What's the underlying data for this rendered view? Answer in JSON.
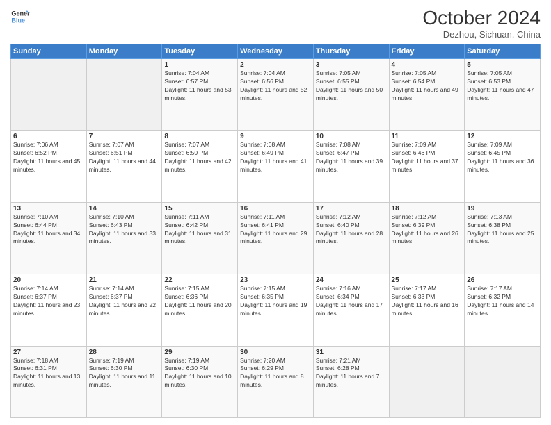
{
  "header": {
    "logo_line1": "General",
    "logo_line2": "Blue",
    "month": "October 2024",
    "location": "Dezhou, Sichuan, China"
  },
  "weekdays": [
    "Sunday",
    "Monday",
    "Tuesday",
    "Wednesday",
    "Thursday",
    "Friday",
    "Saturday"
  ],
  "weeks": [
    [
      {
        "day": "",
        "sunrise": "",
        "sunset": "",
        "daylight": ""
      },
      {
        "day": "",
        "sunrise": "",
        "sunset": "",
        "daylight": ""
      },
      {
        "day": "1",
        "sunrise": "Sunrise: 7:04 AM",
        "sunset": "Sunset: 6:57 PM",
        "daylight": "Daylight: 11 hours and 53 minutes."
      },
      {
        "day": "2",
        "sunrise": "Sunrise: 7:04 AM",
        "sunset": "Sunset: 6:56 PM",
        "daylight": "Daylight: 11 hours and 52 minutes."
      },
      {
        "day": "3",
        "sunrise": "Sunrise: 7:05 AM",
        "sunset": "Sunset: 6:55 PM",
        "daylight": "Daylight: 11 hours and 50 minutes."
      },
      {
        "day": "4",
        "sunrise": "Sunrise: 7:05 AM",
        "sunset": "Sunset: 6:54 PM",
        "daylight": "Daylight: 11 hours and 49 minutes."
      },
      {
        "day": "5",
        "sunrise": "Sunrise: 7:05 AM",
        "sunset": "Sunset: 6:53 PM",
        "daylight": "Daylight: 11 hours and 47 minutes."
      }
    ],
    [
      {
        "day": "6",
        "sunrise": "Sunrise: 7:06 AM",
        "sunset": "Sunset: 6:52 PM",
        "daylight": "Daylight: 11 hours and 45 minutes."
      },
      {
        "day": "7",
        "sunrise": "Sunrise: 7:07 AM",
        "sunset": "Sunset: 6:51 PM",
        "daylight": "Daylight: 11 hours and 44 minutes."
      },
      {
        "day": "8",
        "sunrise": "Sunrise: 7:07 AM",
        "sunset": "Sunset: 6:50 PM",
        "daylight": "Daylight: 11 hours and 42 minutes."
      },
      {
        "day": "9",
        "sunrise": "Sunrise: 7:08 AM",
        "sunset": "Sunset: 6:49 PM",
        "daylight": "Daylight: 11 hours and 41 minutes."
      },
      {
        "day": "10",
        "sunrise": "Sunrise: 7:08 AM",
        "sunset": "Sunset: 6:47 PM",
        "daylight": "Daylight: 11 hours and 39 minutes."
      },
      {
        "day": "11",
        "sunrise": "Sunrise: 7:09 AM",
        "sunset": "Sunset: 6:46 PM",
        "daylight": "Daylight: 11 hours and 37 minutes."
      },
      {
        "day": "12",
        "sunrise": "Sunrise: 7:09 AM",
        "sunset": "Sunset: 6:45 PM",
        "daylight": "Daylight: 11 hours and 36 minutes."
      }
    ],
    [
      {
        "day": "13",
        "sunrise": "Sunrise: 7:10 AM",
        "sunset": "Sunset: 6:44 PM",
        "daylight": "Daylight: 11 hours and 34 minutes."
      },
      {
        "day": "14",
        "sunrise": "Sunrise: 7:10 AM",
        "sunset": "Sunset: 6:43 PM",
        "daylight": "Daylight: 11 hours and 33 minutes."
      },
      {
        "day": "15",
        "sunrise": "Sunrise: 7:11 AM",
        "sunset": "Sunset: 6:42 PM",
        "daylight": "Daylight: 11 hours and 31 minutes."
      },
      {
        "day": "16",
        "sunrise": "Sunrise: 7:11 AM",
        "sunset": "Sunset: 6:41 PM",
        "daylight": "Daylight: 11 hours and 29 minutes."
      },
      {
        "day": "17",
        "sunrise": "Sunrise: 7:12 AM",
        "sunset": "Sunset: 6:40 PM",
        "daylight": "Daylight: 11 hours and 28 minutes."
      },
      {
        "day": "18",
        "sunrise": "Sunrise: 7:12 AM",
        "sunset": "Sunset: 6:39 PM",
        "daylight": "Daylight: 11 hours and 26 minutes."
      },
      {
        "day": "19",
        "sunrise": "Sunrise: 7:13 AM",
        "sunset": "Sunset: 6:38 PM",
        "daylight": "Daylight: 11 hours and 25 minutes."
      }
    ],
    [
      {
        "day": "20",
        "sunrise": "Sunrise: 7:14 AM",
        "sunset": "Sunset: 6:37 PM",
        "daylight": "Daylight: 11 hours and 23 minutes."
      },
      {
        "day": "21",
        "sunrise": "Sunrise: 7:14 AM",
        "sunset": "Sunset: 6:37 PM",
        "daylight": "Daylight: 11 hours and 22 minutes."
      },
      {
        "day": "22",
        "sunrise": "Sunrise: 7:15 AM",
        "sunset": "Sunset: 6:36 PM",
        "daylight": "Daylight: 11 hours and 20 minutes."
      },
      {
        "day": "23",
        "sunrise": "Sunrise: 7:15 AM",
        "sunset": "Sunset: 6:35 PM",
        "daylight": "Daylight: 11 hours and 19 minutes."
      },
      {
        "day": "24",
        "sunrise": "Sunrise: 7:16 AM",
        "sunset": "Sunset: 6:34 PM",
        "daylight": "Daylight: 11 hours and 17 minutes."
      },
      {
        "day": "25",
        "sunrise": "Sunrise: 7:17 AM",
        "sunset": "Sunset: 6:33 PM",
        "daylight": "Daylight: 11 hours and 16 minutes."
      },
      {
        "day": "26",
        "sunrise": "Sunrise: 7:17 AM",
        "sunset": "Sunset: 6:32 PM",
        "daylight": "Daylight: 11 hours and 14 minutes."
      }
    ],
    [
      {
        "day": "27",
        "sunrise": "Sunrise: 7:18 AM",
        "sunset": "Sunset: 6:31 PM",
        "daylight": "Daylight: 11 hours and 13 minutes."
      },
      {
        "day": "28",
        "sunrise": "Sunrise: 7:19 AM",
        "sunset": "Sunset: 6:30 PM",
        "daylight": "Daylight: 11 hours and 11 minutes."
      },
      {
        "day": "29",
        "sunrise": "Sunrise: 7:19 AM",
        "sunset": "Sunset: 6:30 PM",
        "daylight": "Daylight: 11 hours and 10 minutes."
      },
      {
        "day": "30",
        "sunrise": "Sunrise: 7:20 AM",
        "sunset": "Sunset: 6:29 PM",
        "daylight": "Daylight: 11 hours and 8 minutes."
      },
      {
        "day": "31",
        "sunrise": "Sunrise: 7:21 AM",
        "sunset": "Sunset: 6:28 PM",
        "daylight": "Daylight: 11 hours and 7 minutes."
      },
      {
        "day": "",
        "sunrise": "",
        "sunset": "",
        "daylight": ""
      },
      {
        "day": "",
        "sunrise": "",
        "sunset": "",
        "daylight": ""
      }
    ]
  ]
}
